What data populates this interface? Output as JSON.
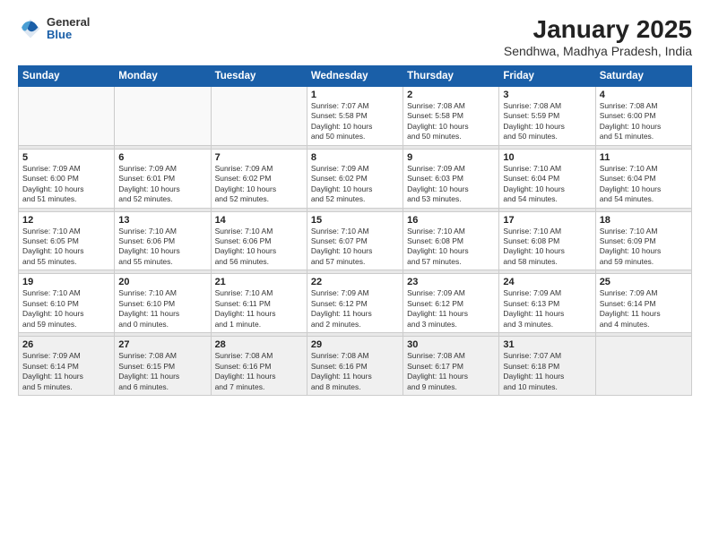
{
  "header": {
    "logo_general": "General",
    "logo_blue": "Blue",
    "month_title": "January 2025",
    "location": "Sendhwa, Madhya Pradesh, India"
  },
  "days_of_week": [
    "Sunday",
    "Monday",
    "Tuesday",
    "Wednesday",
    "Thursday",
    "Friday",
    "Saturday"
  ],
  "weeks": [
    [
      {
        "day": "",
        "info": ""
      },
      {
        "day": "",
        "info": ""
      },
      {
        "day": "",
        "info": ""
      },
      {
        "day": "1",
        "info": "Sunrise: 7:07 AM\nSunset: 5:58 PM\nDaylight: 10 hours\nand 50 minutes."
      },
      {
        "day": "2",
        "info": "Sunrise: 7:08 AM\nSunset: 5:58 PM\nDaylight: 10 hours\nand 50 minutes."
      },
      {
        "day": "3",
        "info": "Sunrise: 7:08 AM\nSunset: 5:59 PM\nDaylight: 10 hours\nand 50 minutes."
      },
      {
        "day": "4",
        "info": "Sunrise: 7:08 AM\nSunset: 6:00 PM\nDaylight: 10 hours\nand 51 minutes."
      }
    ],
    [
      {
        "day": "5",
        "info": "Sunrise: 7:09 AM\nSunset: 6:00 PM\nDaylight: 10 hours\nand 51 minutes."
      },
      {
        "day": "6",
        "info": "Sunrise: 7:09 AM\nSunset: 6:01 PM\nDaylight: 10 hours\nand 52 minutes."
      },
      {
        "day": "7",
        "info": "Sunrise: 7:09 AM\nSunset: 6:02 PM\nDaylight: 10 hours\nand 52 minutes."
      },
      {
        "day": "8",
        "info": "Sunrise: 7:09 AM\nSunset: 6:02 PM\nDaylight: 10 hours\nand 52 minutes."
      },
      {
        "day": "9",
        "info": "Sunrise: 7:09 AM\nSunset: 6:03 PM\nDaylight: 10 hours\nand 53 minutes."
      },
      {
        "day": "10",
        "info": "Sunrise: 7:10 AM\nSunset: 6:04 PM\nDaylight: 10 hours\nand 54 minutes."
      },
      {
        "day": "11",
        "info": "Sunrise: 7:10 AM\nSunset: 6:04 PM\nDaylight: 10 hours\nand 54 minutes."
      }
    ],
    [
      {
        "day": "12",
        "info": "Sunrise: 7:10 AM\nSunset: 6:05 PM\nDaylight: 10 hours\nand 55 minutes."
      },
      {
        "day": "13",
        "info": "Sunrise: 7:10 AM\nSunset: 6:06 PM\nDaylight: 10 hours\nand 55 minutes."
      },
      {
        "day": "14",
        "info": "Sunrise: 7:10 AM\nSunset: 6:06 PM\nDaylight: 10 hours\nand 56 minutes."
      },
      {
        "day": "15",
        "info": "Sunrise: 7:10 AM\nSunset: 6:07 PM\nDaylight: 10 hours\nand 57 minutes."
      },
      {
        "day": "16",
        "info": "Sunrise: 7:10 AM\nSunset: 6:08 PM\nDaylight: 10 hours\nand 57 minutes."
      },
      {
        "day": "17",
        "info": "Sunrise: 7:10 AM\nSunset: 6:08 PM\nDaylight: 10 hours\nand 58 minutes."
      },
      {
        "day": "18",
        "info": "Sunrise: 7:10 AM\nSunset: 6:09 PM\nDaylight: 10 hours\nand 59 minutes."
      }
    ],
    [
      {
        "day": "19",
        "info": "Sunrise: 7:10 AM\nSunset: 6:10 PM\nDaylight: 10 hours\nand 59 minutes."
      },
      {
        "day": "20",
        "info": "Sunrise: 7:10 AM\nSunset: 6:10 PM\nDaylight: 11 hours\nand 0 minutes."
      },
      {
        "day": "21",
        "info": "Sunrise: 7:10 AM\nSunset: 6:11 PM\nDaylight: 11 hours\nand 1 minute."
      },
      {
        "day": "22",
        "info": "Sunrise: 7:09 AM\nSunset: 6:12 PM\nDaylight: 11 hours\nand 2 minutes."
      },
      {
        "day": "23",
        "info": "Sunrise: 7:09 AM\nSunset: 6:12 PM\nDaylight: 11 hours\nand 3 minutes."
      },
      {
        "day": "24",
        "info": "Sunrise: 7:09 AM\nSunset: 6:13 PM\nDaylight: 11 hours\nand 3 minutes."
      },
      {
        "day": "25",
        "info": "Sunrise: 7:09 AM\nSunset: 6:14 PM\nDaylight: 11 hours\nand 4 minutes."
      }
    ],
    [
      {
        "day": "26",
        "info": "Sunrise: 7:09 AM\nSunset: 6:14 PM\nDaylight: 11 hours\nand 5 minutes."
      },
      {
        "day": "27",
        "info": "Sunrise: 7:08 AM\nSunset: 6:15 PM\nDaylight: 11 hours\nand 6 minutes."
      },
      {
        "day": "28",
        "info": "Sunrise: 7:08 AM\nSunset: 6:16 PM\nDaylight: 11 hours\nand 7 minutes."
      },
      {
        "day": "29",
        "info": "Sunrise: 7:08 AM\nSunset: 6:16 PM\nDaylight: 11 hours\nand 8 minutes."
      },
      {
        "day": "30",
        "info": "Sunrise: 7:08 AM\nSunset: 6:17 PM\nDaylight: 11 hours\nand 9 minutes."
      },
      {
        "day": "31",
        "info": "Sunrise: 7:07 AM\nSunset: 6:18 PM\nDaylight: 11 hours\nand 10 minutes."
      },
      {
        "day": "",
        "info": ""
      }
    ]
  ]
}
